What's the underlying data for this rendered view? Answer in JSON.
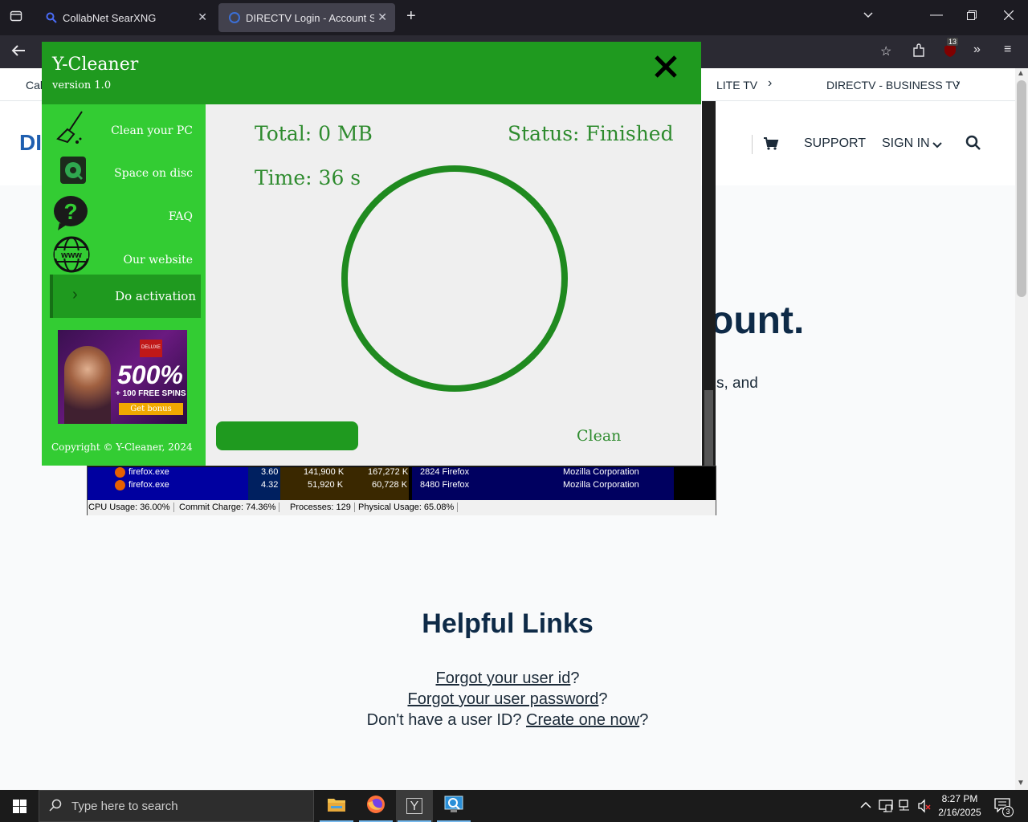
{
  "browser": {
    "tabs": [
      {
        "title": "CollabNet SearXNG",
        "active": false
      },
      {
        "title": "DIRECTV Login - Account Sign In",
        "active": true
      }
    ],
    "new_tab_label": "+",
    "extension_badge": "13"
  },
  "page": {
    "subnav": {
      "left_item": "Cal",
      "item_satellite": "LITE TV",
      "item_business": "DIRECTV - BUSINESS TV"
    },
    "logo_partial": "DI",
    "header_links": {
      "support": "SUPPORT",
      "sign_in": "SIGN IN"
    },
    "hero_partial": "ount.",
    "hero_sub_partial": "s, and",
    "helpful_title": "Helpful Links",
    "forgot_id_link": "Forgot your user id",
    "forgot_id_q": "?",
    "forgot_pw_link": "Forgot your user password",
    "forgot_pw_q": "?",
    "no_id_text": "Don't have a user ID? ",
    "create_link": "Create one now",
    "create_q": "?"
  },
  "task_manager": {
    "rows": [
      {
        "name": "firefox.exe",
        "cpu": "3.60",
        "private": "141,900 K",
        "working": "167,272 K",
        "pid_desc": "2824 Firefox",
        "company": "Mozilla Corporation"
      },
      {
        "name": "firefox.exe",
        "cpu": "4.32",
        "private": "51,920 K",
        "working": "60,728 K",
        "pid_desc": "8480 Firefox",
        "company": "Mozilla Corporation"
      }
    ],
    "status": {
      "cpu": "CPU Usage: 36.00%",
      "commit": "Commit Charge: 74.36%",
      "processes": "Processes: 129",
      "physical": "Physical Usage: 65.08%"
    }
  },
  "ycleaner": {
    "title": "Y-Cleaner",
    "version": "version 1.0",
    "menu": [
      {
        "label": "Clean your PC",
        "icon": "broom-icon"
      },
      {
        "label": "Space on disc",
        "icon": "disk-icon"
      },
      {
        "label": "FAQ",
        "icon": "question-icon"
      },
      {
        "label": "Our website",
        "icon": "www-icon"
      }
    ],
    "activation_label": "Do activation",
    "ad": {
      "headline": "500%",
      "sub": "+ 100 FREE SPINS",
      "button": "Get bonus",
      "badge": "DELUXE"
    },
    "copyright": "Copyright © Y-Cleaner, 2024",
    "total": "Total: 0 MB",
    "status": "Status: Finished",
    "time": "Time: 36 s",
    "clean_label": "Clean",
    "accent": "#1f9a1f",
    "sidebar_color": "#33cc33"
  },
  "taskbar": {
    "search_placeholder": "Type here to search",
    "time": "8:27 PM",
    "date": "2/16/2025",
    "notification_count": "3"
  }
}
